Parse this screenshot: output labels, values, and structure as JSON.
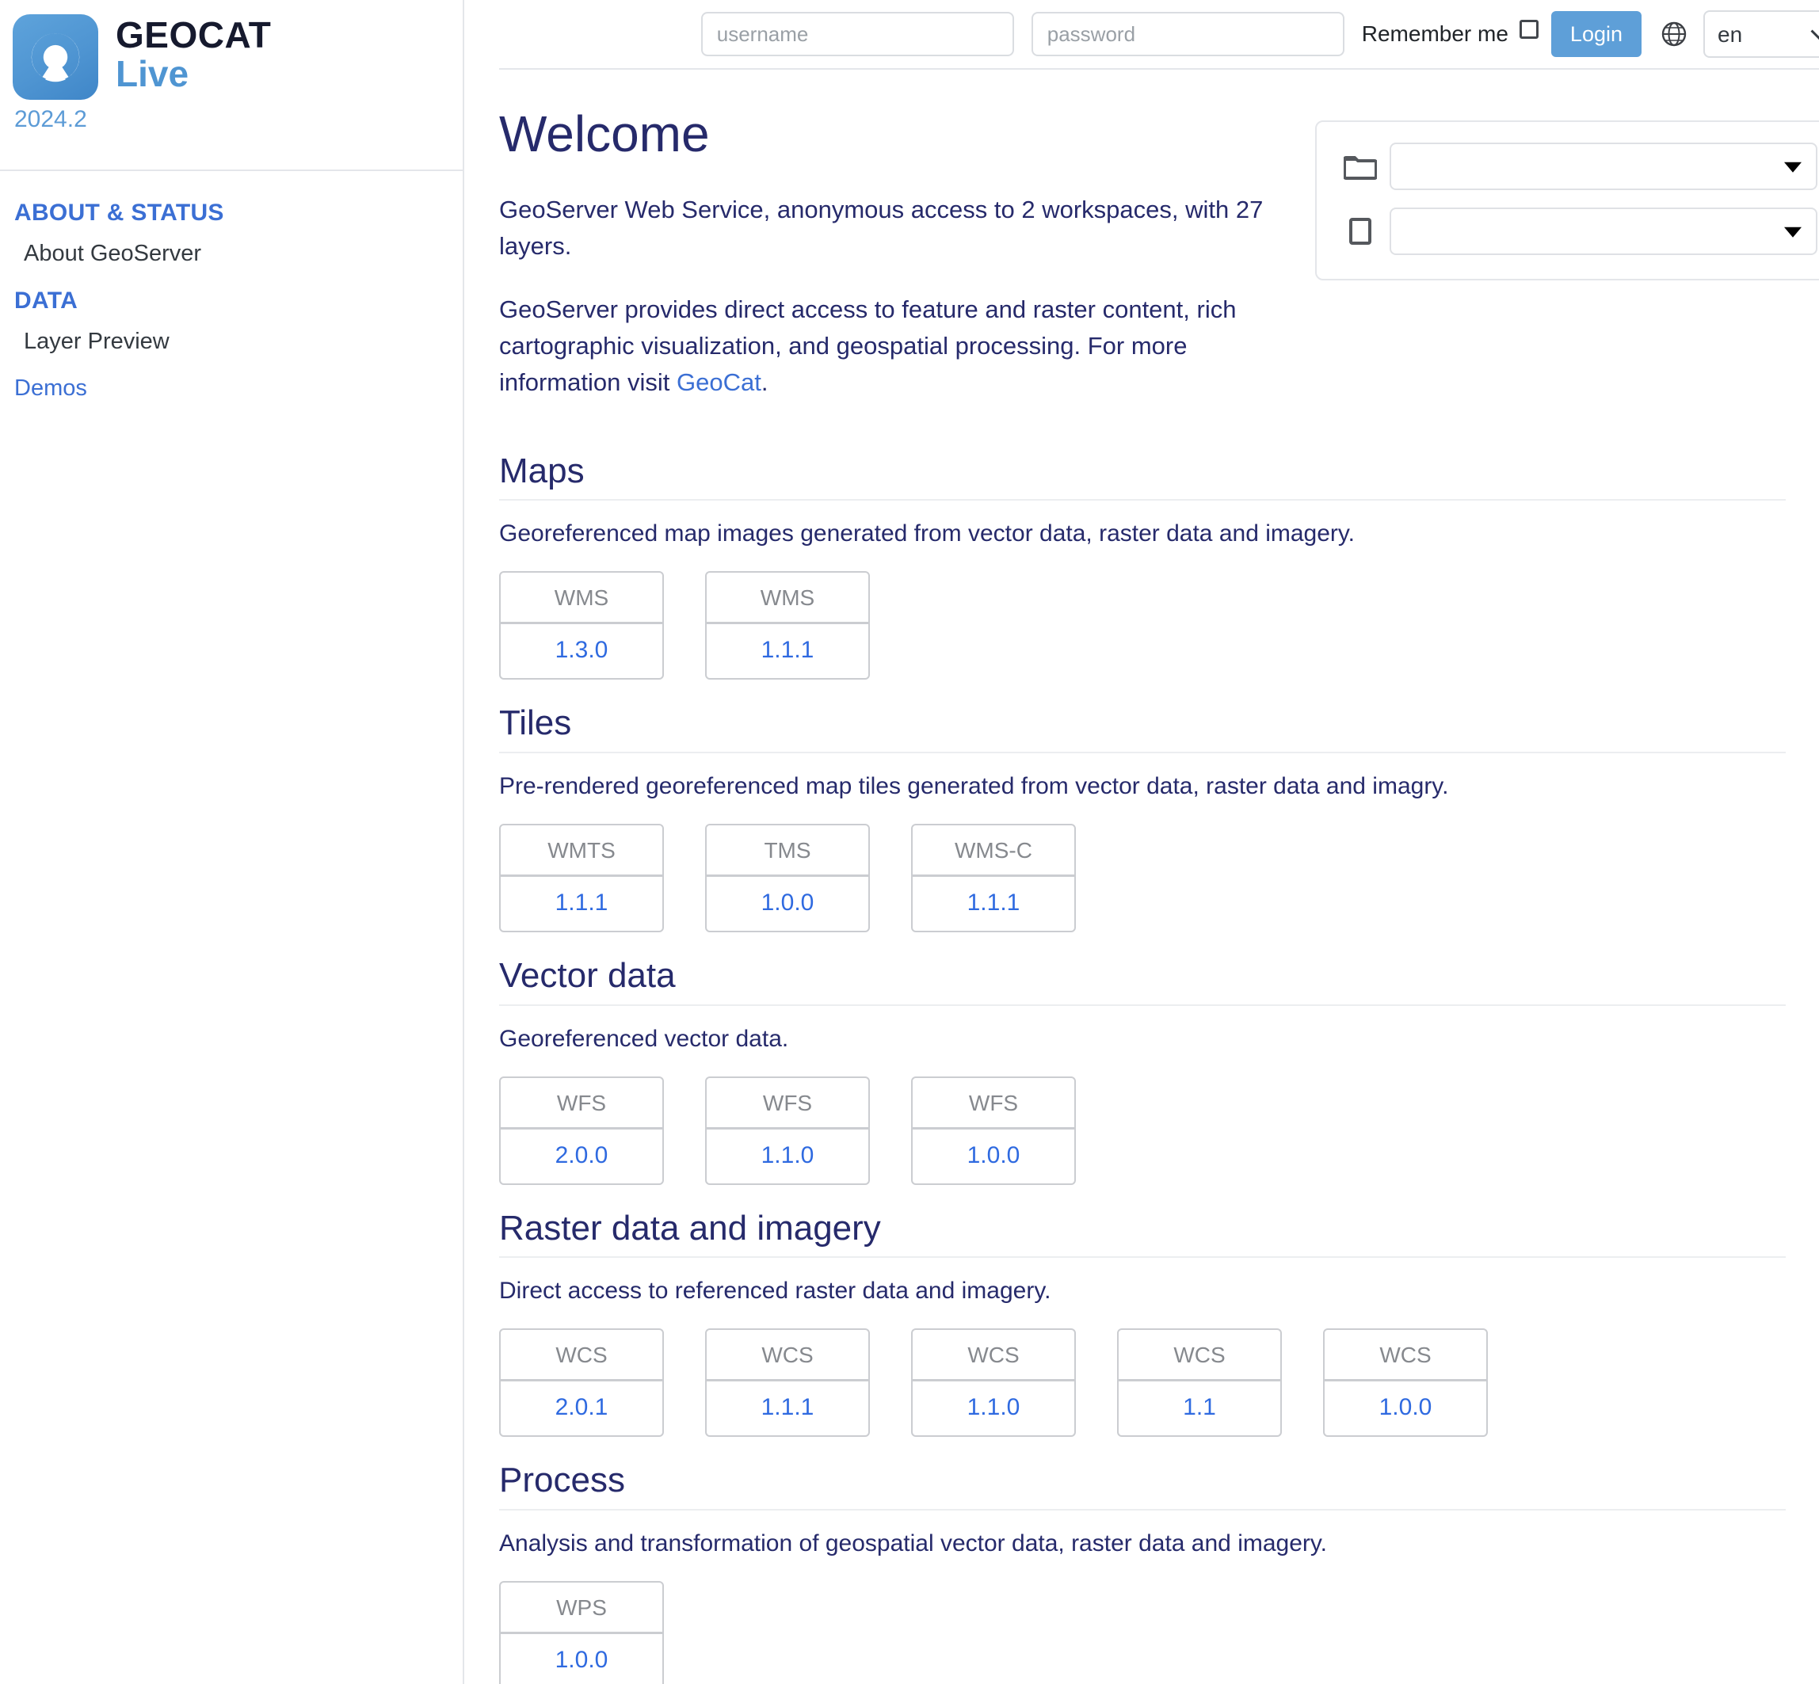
{
  "brand": {
    "logo_icon": "geocat-radar-logo-icon",
    "name_top": "GEOCAT",
    "name_bottom": "Live",
    "version": "2024.2"
  },
  "sidebar": {
    "groups": [
      {
        "header": "ABOUT & STATUS",
        "items": [
          {
            "label": "About GeoServer",
            "style": "plain"
          }
        ]
      },
      {
        "header": "DATA",
        "items": [
          {
            "label": "Layer Preview",
            "style": "plain"
          }
        ]
      }
    ],
    "demos_label": "Demos"
  },
  "loginbar": {
    "username_placeholder": "username",
    "username_value": "",
    "password_placeholder": "password",
    "password_value": "",
    "remember_label": "Remember me",
    "remember_checked": false,
    "login_label": "Login",
    "globe_icon": "globe-icon",
    "language_selected": "en",
    "language_options": [
      "en"
    ]
  },
  "welcome": {
    "title": "Welcome",
    "summary": "GeoServer Web Service, anonymous access to 2 workspaces, with 27 layers.",
    "description_before_link": "GeoServer provides direct access to feature and raster content, rich cartographic visualization, and geospatial processing. For more information visit ",
    "link_text": "GeoCat",
    "description_after_link": ".",
    "workspaces_count": "2",
    "layers_count": "27"
  },
  "selector": {
    "workspace": {
      "icon": "folder-icon",
      "value": "",
      "options": []
    },
    "layer": {
      "icon": "layer-page-icon",
      "value": "",
      "options": []
    }
  },
  "sections": [
    {
      "title": "Maps",
      "description": "Georeferenced map images generated from vector data, raster data and imagery.",
      "cards": [
        {
          "name": "WMS",
          "version": "1.3.0"
        },
        {
          "name": "WMS",
          "version": "1.1.1"
        }
      ]
    },
    {
      "title": "Tiles",
      "description": "Pre-rendered georeferenced map tiles generated from vector data, raster data and imagry.",
      "cards": [
        {
          "name": "WMTS",
          "version": "1.1.1"
        },
        {
          "name": "TMS",
          "version": "1.0.0"
        },
        {
          "name": "WMS-C",
          "version": "1.1.1"
        }
      ]
    },
    {
      "title": "Vector data",
      "description": "Georeferenced vector data.",
      "cards": [
        {
          "name": "WFS",
          "version": "2.0.0"
        },
        {
          "name": "WFS",
          "version": "1.1.0"
        },
        {
          "name": "WFS",
          "version": "1.0.0"
        }
      ]
    },
    {
      "title": "Raster data and imagery",
      "description": "Direct access to referenced raster data and imagery.",
      "cards": [
        {
          "name": "WCS",
          "version": "2.0.1"
        },
        {
          "name": "WCS",
          "version": "1.1.1"
        },
        {
          "name": "WCS",
          "version": "1.1.0"
        },
        {
          "name": "WCS",
          "version": "1.1"
        },
        {
          "name": "WCS",
          "version": "1.0.0"
        }
      ]
    },
    {
      "title": "Process",
      "description": "Analysis and transformation of geospatial vector data, raster data and imagery.",
      "cards": [
        {
          "name": "WPS",
          "version": "1.0.0"
        }
      ]
    }
  ],
  "colors": {
    "brand_blue": "#4f95d2",
    "heading_navy": "#262a6b",
    "link_blue": "#3b6fd4",
    "version_blue": "#2f6ae0",
    "button_blue": "#5e9fd8",
    "border_gray": "#cbcdd1"
  }
}
